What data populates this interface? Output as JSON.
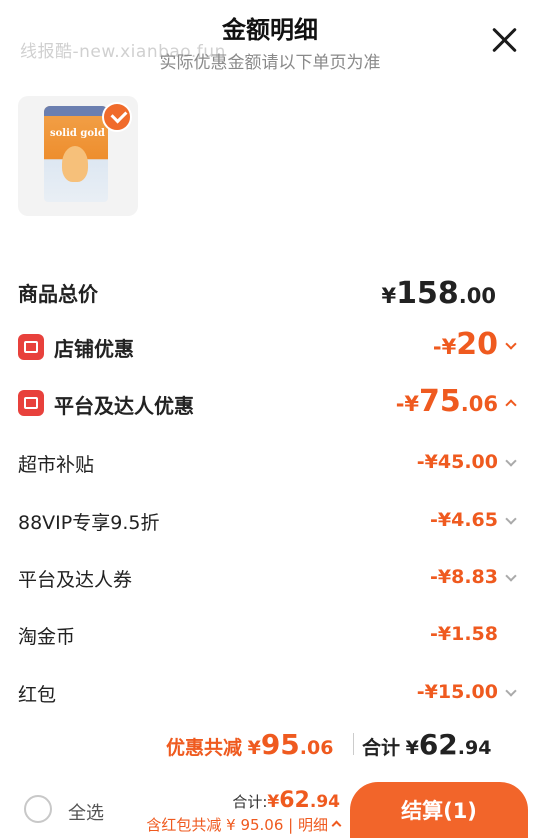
{
  "header": {
    "title": "金额明细",
    "subtitle": "实际优惠金额请以下单页为准",
    "watermark": "线报酷-new.xianbao.fun"
  },
  "product": {
    "brand_on_bag": "solid gold",
    "selected": true
  },
  "rows": {
    "total": {
      "label": "商品总价",
      "symbol": "¥",
      "int": "158",
      "dec": ".00"
    },
    "shop": {
      "label": "店铺优惠",
      "prefix": "-¥",
      "int": "20",
      "dec": ""
    },
    "platform": {
      "label": "平台及达人优惠",
      "prefix": "-¥",
      "int": "75",
      "dec": ".06"
    },
    "supermarket": {
      "label": "超市补贴",
      "prefix": "-¥",
      "int": "45",
      "dec": ".00"
    },
    "vip": {
      "label": "88VIP专享9.5折",
      "prefix": "-¥",
      "int": "4",
      "dec": ".65"
    },
    "coupon": {
      "label": "平台及达人券",
      "prefix": "-¥",
      "int": "8",
      "dec": ".83"
    },
    "coin": {
      "label": "淘金币",
      "prefix": "-¥",
      "int": "1",
      "dec": ".58"
    },
    "redpacket": {
      "label": "红包",
      "prefix": "-¥",
      "int": "15",
      "dec": ".00"
    }
  },
  "summary": {
    "discount_label": "优惠共减",
    "discount_symbol": "¥",
    "discount_int": "95",
    "discount_dec": ".06",
    "total_label": "合计",
    "total_symbol": "¥",
    "total_int": "62",
    "total_dec": ".94"
  },
  "bottom": {
    "select_all": "全选",
    "total_label": "合计:",
    "total_symbol": "¥",
    "total_int": "62",
    "total_dec": ".94",
    "detail_text": "含红包共减 ¥ 95.06 | 明细",
    "checkout_label": "结算(1)"
  },
  "colors": {
    "accent": "#ef5a1f",
    "badge": "#e8413c",
    "button": "#f2652a"
  }
}
